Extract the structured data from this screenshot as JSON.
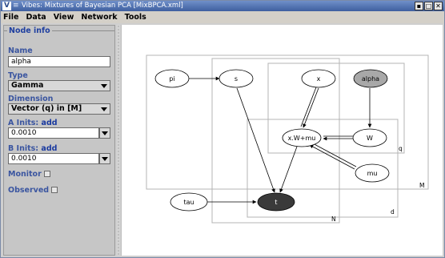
{
  "window": {
    "title": "Vibes: Mixtures of Bayesian PCA [MixBPCA.xml]",
    "app_icon_letter": "V",
    "menu_glyph": "≡",
    "buttons": [
      "▪",
      "□",
      "✕"
    ]
  },
  "menubar": {
    "items": [
      "File",
      "Data",
      "View",
      "Network",
      "Tools"
    ]
  },
  "node_info": {
    "section_title": "Node info",
    "name_label": "Name",
    "name_value": "alpha",
    "type_label": "Type",
    "type_value": "Gamma",
    "dimension_label": "Dimension",
    "dimension_value": "Vector (q) in [M]",
    "a_inits_label": "A Inits:",
    "a_inits_link": "add",
    "a_inits_value": "0.0010",
    "b_inits_label": "B Inits:",
    "b_inits_link": "add",
    "b_inits_value": "0.0010",
    "monitor_label": "Monitor",
    "observed_label": "Observed"
  },
  "network": {
    "nodes": [
      {
        "id": "pi",
        "label": "pi",
        "style": "plain"
      },
      {
        "id": "s",
        "label": "s",
        "style": "plain"
      },
      {
        "id": "x",
        "label": "x",
        "style": "plain"
      },
      {
        "id": "alpha",
        "label": "alpha",
        "style": "selected"
      },
      {
        "id": "xwmu",
        "label": "x.W+mu",
        "style": "plain"
      },
      {
        "id": "W",
        "label": "W",
        "style": "plain"
      },
      {
        "id": "mu",
        "label": "mu",
        "style": "plain"
      },
      {
        "id": "tau",
        "label": "tau",
        "style": "plain"
      },
      {
        "id": "t",
        "label": "t",
        "style": "observed"
      }
    ],
    "plates": [
      {
        "id": "M",
        "label": "M"
      },
      {
        "id": "N",
        "label": "N"
      },
      {
        "id": "q",
        "label": "q"
      },
      {
        "id": "d",
        "label": "d"
      }
    ],
    "edges": [
      {
        "from": "pi",
        "to": "s",
        "kind": "stochastic"
      },
      {
        "from": "s",
        "to": "t",
        "kind": "stochastic"
      },
      {
        "from": "x",
        "to": "xwmu",
        "kind": "deterministic"
      },
      {
        "from": "alpha",
        "to": "W",
        "kind": "stochastic"
      },
      {
        "from": "W",
        "to": "xwmu",
        "kind": "deterministic"
      },
      {
        "from": "mu",
        "to": "xwmu",
        "kind": "deterministic"
      },
      {
        "from": "xwmu",
        "to": "t",
        "kind": "stochastic"
      },
      {
        "from": "tau",
        "to": "t",
        "kind": "stochastic"
      }
    ]
  }
}
